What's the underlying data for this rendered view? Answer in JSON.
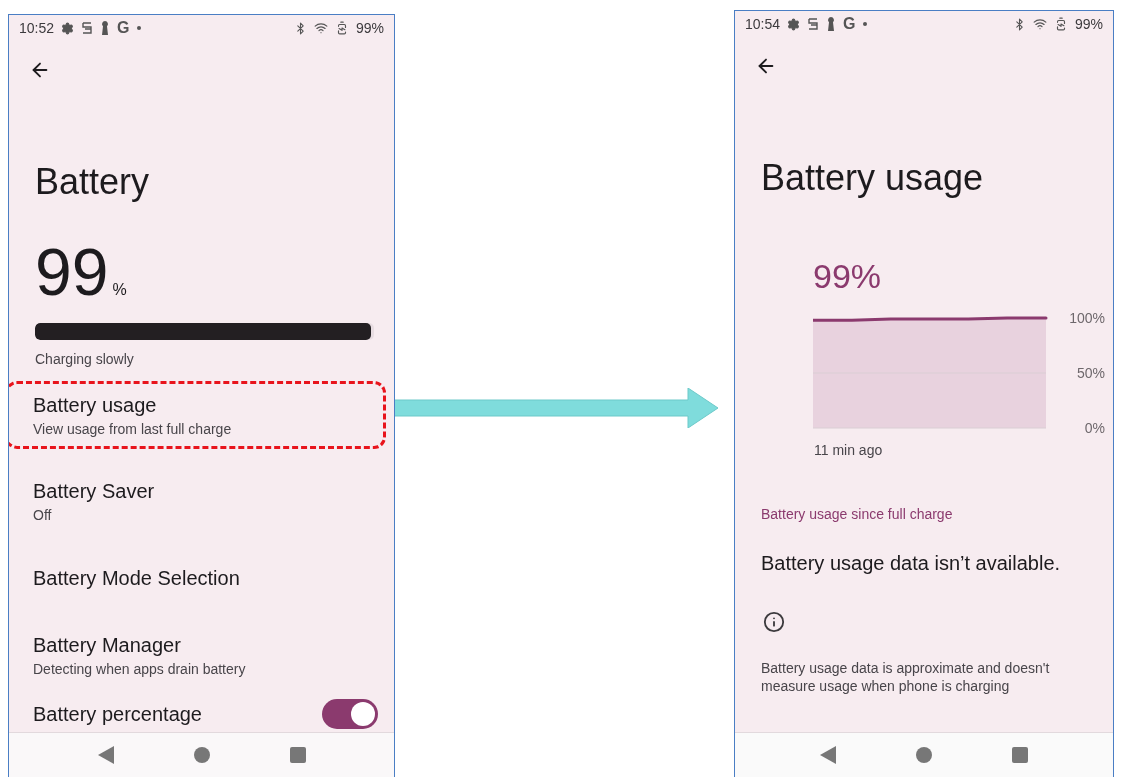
{
  "left_screen": {
    "status_bar": {
      "time": "10:52",
      "g_label": "G",
      "battery_text": "99%"
    },
    "title": "Battery",
    "level_value": "99",
    "level_unit": "%",
    "battery_bar": {
      "level": 0.99
    },
    "charging_status": "Charging slowly",
    "items": [
      {
        "kind": "text",
        "title": "Battery usage",
        "subtitle": "View usage from last full charge",
        "highlighted": true
      },
      {
        "kind": "text",
        "title": "Battery Saver",
        "subtitle": "Off",
        "highlighted": false
      },
      {
        "kind": "text",
        "title": "Battery Mode Selection",
        "highlighted": false
      },
      {
        "kind": "text",
        "title": "Battery Manager",
        "subtitle": "Detecting when apps drain battery",
        "highlighted": false
      },
      {
        "kind": "toggle",
        "title": "Battery percentage",
        "on": true,
        "highlighted": false
      }
    ]
  },
  "right_screen": {
    "status_bar": {
      "time": "10:54",
      "g_label": "G",
      "battery_text": "99%"
    },
    "title": "Battery usage",
    "level_text": "99%",
    "chart_data": {
      "type": "area",
      "xlabel": "11 min ago",
      "series": [
        {
          "color": "#8b3a6e",
          "values": [
            98,
            98,
            99,
            99,
            99,
            100,
            100
          ]
        }
      ],
      "ylim": [
        0,
        100
      ],
      "yticks": [
        {
          "value": 0,
          "label": "0%"
        },
        {
          "value": 50,
          "label": "50%"
        },
        {
          "value": 100,
          "label": "100%"
        }
      ]
    },
    "section_header": "Battery usage since full charge",
    "message": "Battery usage data isn’t available.",
    "footnote": "Battery usage data is approximate and doesn't measure usage when phone is charging"
  }
}
